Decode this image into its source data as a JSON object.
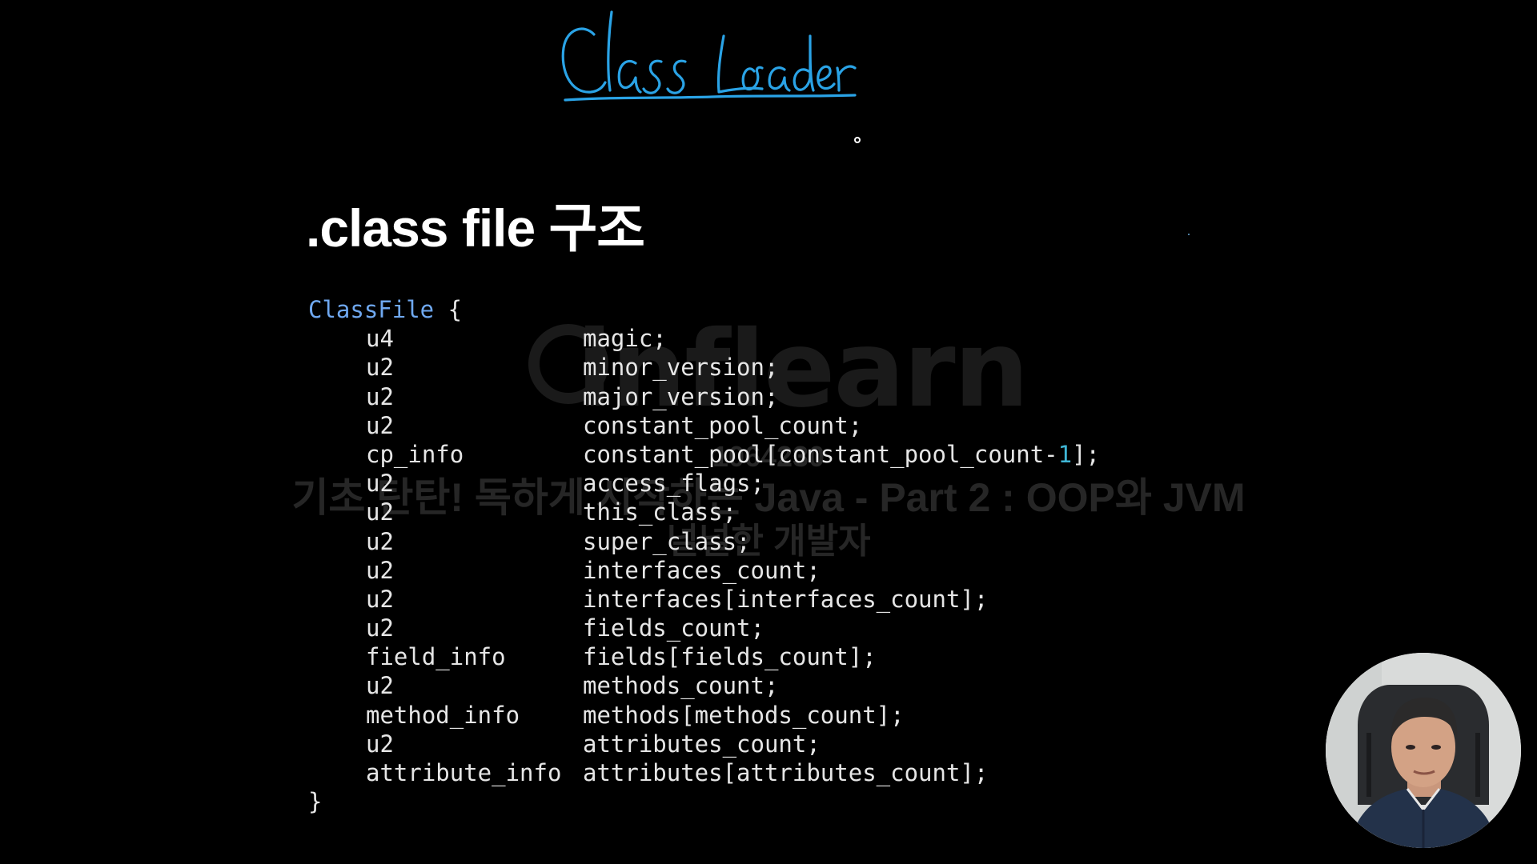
{
  "annotation": {
    "handwritten_title": "Class Loader",
    "ink_color": "#2aa3e6"
  },
  "watermark": {
    "logo": "inflearn",
    "id_text": "1064230",
    "course": "기초 탄탄! 독하게 시작하는 Java - Part 2 : OOP와 JVM",
    "subtitle": "널널한 개발자"
  },
  "slide": {
    "title": ".class file 구조"
  },
  "code": {
    "open_keyword": "ClassFile",
    "open_brace": " {",
    "close_brace": "}",
    "lines": [
      {
        "type": "u4",
        "field": "magic;"
      },
      {
        "type": "u2",
        "field": "minor_version;"
      },
      {
        "type": "u2",
        "field": "major_version;"
      },
      {
        "type": "u2",
        "field": "constant_pool_count;"
      },
      {
        "type": "cp_info",
        "field_pre": "constant_pool[constant_pool_count-",
        "field_num": "1",
        "field_post": "];"
      },
      {
        "type": "u2",
        "field": "access_flags;"
      },
      {
        "type": "u2",
        "field": "this_class;"
      },
      {
        "type": "u2",
        "field": "super_class;"
      },
      {
        "type": "u2",
        "field": "interfaces_count;"
      },
      {
        "type": "u2",
        "field": "interfaces[interfaces_count];"
      },
      {
        "type": "u2",
        "field": "fields_count;"
      },
      {
        "type": "field_info",
        "field": "fields[fields_count];"
      },
      {
        "type": "u2",
        "field": "methods_count;"
      },
      {
        "type": "method_info",
        "field": "methods[methods_count];"
      },
      {
        "type": "u2",
        "field": "attributes_count;"
      },
      {
        "type": "attribute_info",
        "field": "attributes[attributes_count];"
      }
    ]
  },
  "colors": {
    "background": "#000000",
    "keyword": "#6fa8f0",
    "number": "#3fb6d6",
    "text": "#e6e6e6"
  }
}
